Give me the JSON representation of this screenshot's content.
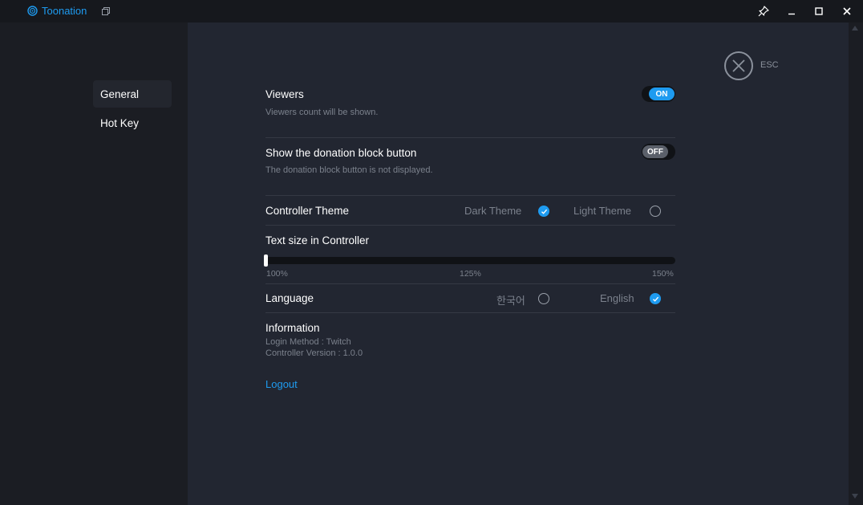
{
  "app": {
    "name": "Toonation"
  },
  "sidebar": {
    "items": [
      {
        "label": "General"
      },
      {
        "label": "Hot Key"
      }
    ]
  },
  "esc": {
    "label": "ESC"
  },
  "settings": {
    "viewers": {
      "title": "Viewers",
      "description": "Viewers count will be shown.",
      "state": "ON"
    },
    "donation_block": {
      "title": "Show the donation block button",
      "description": "The donation block button is not displayed.",
      "state": "OFF"
    },
    "theme": {
      "title": "Controller Theme",
      "options": [
        {
          "label": "Dark Theme",
          "selected": true
        },
        {
          "label": "Light Theme",
          "selected": false
        }
      ]
    },
    "text_size": {
      "title": "Text size in Controller",
      "ticks": [
        "100%",
        "125%",
        "150%"
      ],
      "value_percent": 100
    },
    "language": {
      "title": "Language",
      "options": [
        {
          "label": "한국어",
          "selected": false
        },
        {
          "label": "English",
          "selected": true
        }
      ]
    },
    "information": {
      "title": "Information",
      "login_method": "Login Method : Twitch",
      "version": "Controller Version : 1.0.0"
    },
    "logout_label": "Logout"
  },
  "colors": {
    "accent": "#1e9bf0",
    "background": "#222631",
    "sidebar": "#1b1d23"
  },
  "icons": {
    "brand": "toonation-logo-icon",
    "restore": "restore-icon",
    "pin": "pin-icon",
    "minimize": "minimize-icon",
    "maximize": "maximize-icon",
    "close": "close-icon"
  }
}
